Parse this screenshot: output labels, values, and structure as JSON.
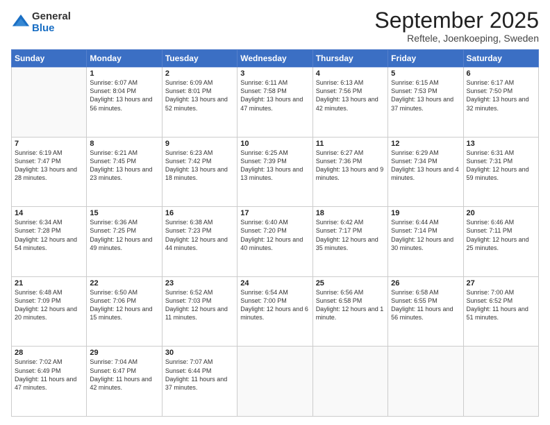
{
  "logo": {
    "general": "General",
    "blue": "Blue"
  },
  "header": {
    "month": "September 2025",
    "location": "Reftele, Joenkoeping, Sweden"
  },
  "days_of_week": [
    "Sunday",
    "Monday",
    "Tuesday",
    "Wednesday",
    "Thursday",
    "Friday",
    "Saturday"
  ],
  "weeks": [
    [
      {
        "day": "",
        "sunrise": "",
        "sunset": "",
        "daylight": ""
      },
      {
        "day": "1",
        "sunrise": "Sunrise: 6:07 AM",
        "sunset": "Sunset: 8:04 PM",
        "daylight": "Daylight: 13 hours and 56 minutes."
      },
      {
        "day": "2",
        "sunrise": "Sunrise: 6:09 AM",
        "sunset": "Sunset: 8:01 PM",
        "daylight": "Daylight: 13 hours and 52 minutes."
      },
      {
        "day": "3",
        "sunrise": "Sunrise: 6:11 AM",
        "sunset": "Sunset: 7:58 PM",
        "daylight": "Daylight: 13 hours and 47 minutes."
      },
      {
        "day": "4",
        "sunrise": "Sunrise: 6:13 AM",
        "sunset": "Sunset: 7:56 PM",
        "daylight": "Daylight: 13 hours and 42 minutes."
      },
      {
        "day": "5",
        "sunrise": "Sunrise: 6:15 AM",
        "sunset": "Sunset: 7:53 PM",
        "daylight": "Daylight: 13 hours and 37 minutes."
      },
      {
        "day": "6",
        "sunrise": "Sunrise: 6:17 AM",
        "sunset": "Sunset: 7:50 PM",
        "daylight": "Daylight: 13 hours and 32 minutes."
      }
    ],
    [
      {
        "day": "7",
        "sunrise": "Sunrise: 6:19 AM",
        "sunset": "Sunset: 7:47 PM",
        "daylight": "Daylight: 13 hours and 28 minutes."
      },
      {
        "day": "8",
        "sunrise": "Sunrise: 6:21 AM",
        "sunset": "Sunset: 7:45 PM",
        "daylight": "Daylight: 13 hours and 23 minutes."
      },
      {
        "day": "9",
        "sunrise": "Sunrise: 6:23 AM",
        "sunset": "Sunset: 7:42 PM",
        "daylight": "Daylight: 13 hours and 18 minutes."
      },
      {
        "day": "10",
        "sunrise": "Sunrise: 6:25 AM",
        "sunset": "Sunset: 7:39 PM",
        "daylight": "Daylight: 13 hours and 13 minutes."
      },
      {
        "day": "11",
        "sunrise": "Sunrise: 6:27 AM",
        "sunset": "Sunset: 7:36 PM",
        "daylight": "Daylight: 13 hours and 9 minutes."
      },
      {
        "day": "12",
        "sunrise": "Sunrise: 6:29 AM",
        "sunset": "Sunset: 7:34 PM",
        "daylight": "Daylight: 13 hours and 4 minutes."
      },
      {
        "day": "13",
        "sunrise": "Sunrise: 6:31 AM",
        "sunset": "Sunset: 7:31 PM",
        "daylight": "Daylight: 12 hours and 59 minutes."
      }
    ],
    [
      {
        "day": "14",
        "sunrise": "Sunrise: 6:34 AM",
        "sunset": "Sunset: 7:28 PM",
        "daylight": "Daylight: 12 hours and 54 minutes."
      },
      {
        "day": "15",
        "sunrise": "Sunrise: 6:36 AM",
        "sunset": "Sunset: 7:25 PM",
        "daylight": "Daylight: 12 hours and 49 minutes."
      },
      {
        "day": "16",
        "sunrise": "Sunrise: 6:38 AM",
        "sunset": "Sunset: 7:23 PM",
        "daylight": "Daylight: 12 hours and 44 minutes."
      },
      {
        "day": "17",
        "sunrise": "Sunrise: 6:40 AM",
        "sunset": "Sunset: 7:20 PM",
        "daylight": "Daylight: 12 hours and 40 minutes."
      },
      {
        "day": "18",
        "sunrise": "Sunrise: 6:42 AM",
        "sunset": "Sunset: 7:17 PM",
        "daylight": "Daylight: 12 hours and 35 minutes."
      },
      {
        "day": "19",
        "sunrise": "Sunrise: 6:44 AM",
        "sunset": "Sunset: 7:14 PM",
        "daylight": "Daylight: 12 hours and 30 minutes."
      },
      {
        "day": "20",
        "sunrise": "Sunrise: 6:46 AM",
        "sunset": "Sunset: 7:11 PM",
        "daylight": "Daylight: 12 hours and 25 minutes."
      }
    ],
    [
      {
        "day": "21",
        "sunrise": "Sunrise: 6:48 AM",
        "sunset": "Sunset: 7:09 PM",
        "daylight": "Daylight: 12 hours and 20 minutes."
      },
      {
        "day": "22",
        "sunrise": "Sunrise: 6:50 AM",
        "sunset": "Sunset: 7:06 PM",
        "daylight": "Daylight: 12 hours and 15 minutes."
      },
      {
        "day": "23",
        "sunrise": "Sunrise: 6:52 AM",
        "sunset": "Sunset: 7:03 PM",
        "daylight": "Daylight: 12 hours and 11 minutes."
      },
      {
        "day": "24",
        "sunrise": "Sunrise: 6:54 AM",
        "sunset": "Sunset: 7:00 PM",
        "daylight": "Daylight: 12 hours and 6 minutes."
      },
      {
        "day": "25",
        "sunrise": "Sunrise: 6:56 AM",
        "sunset": "Sunset: 6:58 PM",
        "daylight": "Daylight: 12 hours and 1 minute."
      },
      {
        "day": "26",
        "sunrise": "Sunrise: 6:58 AM",
        "sunset": "Sunset: 6:55 PM",
        "daylight": "Daylight: 11 hours and 56 minutes."
      },
      {
        "day": "27",
        "sunrise": "Sunrise: 7:00 AM",
        "sunset": "Sunset: 6:52 PM",
        "daylight": "Daylight: 11 hours and 51 minutes."
      }
    ],
    [
      {
        "day": "28",
        "sunrise": "Sunrise: 7:02 AM",
        "sunset": "Sunset: 6:49 PM",
        "daylight": "Daylight: 11 hours and 47 minutes."
      },
      {
        "day": "29",
        "sunrise": "Sunrise: 7:04 AM",
        "sunset": "Sunset: 6:47 PM",
        "daylight": "Daylight: 11 hours and 42 minutes."
      },
      {
        "day": "30",
        "sunrise": "Sunrise: 7:07 AM",
        "sunset": "Sunset: 6:44 PM",
        "daylight": "Daylight: 11 hours and 37 minutes."
      },
      {
        "day": "",
        "sunrise": "",
        "sunset": "",
        "daylight": ""
      },
      {
        "day": "",
        "sunrise": "",
        "sunset": "",
        "daylight": ""
      },
      {
        "day": "",
        "sunrise": "",
        "sunset": "",
        "daylight": ""
      },
      {
        "day": "",
        "sunrise": "",
        "sunset": "",
        "daylight": ""
      }
    ]
  ]
}
